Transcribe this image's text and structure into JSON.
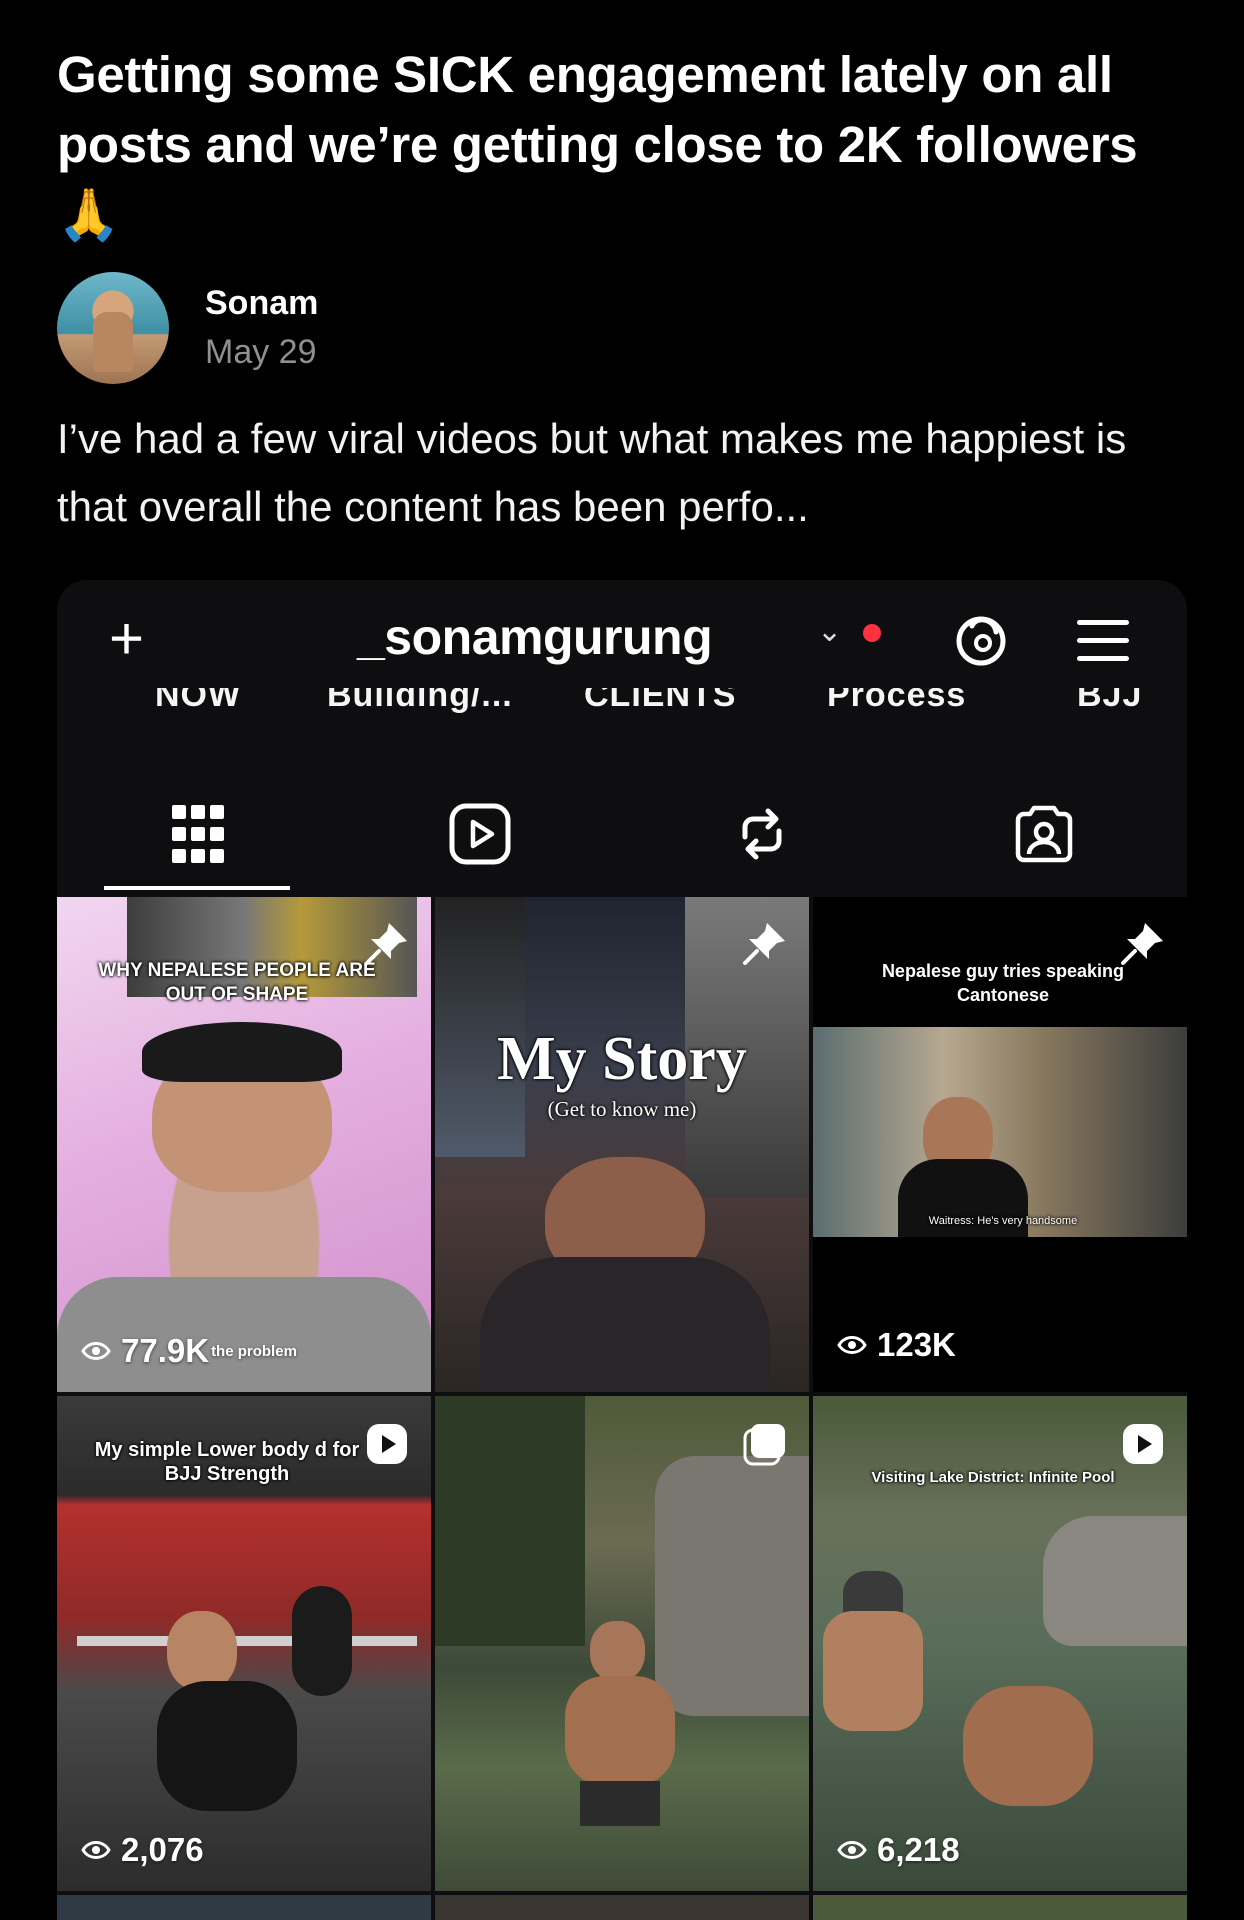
{
  "post": {
    "title": "Getting some SICK engagement lately on all posts and we’re getting close to 2K followers 🙏",
    "author": "Sonam",
    "date": "May 29",
    "body": "I’ve had a few viral videos but what makes me happiest is that overall the content has been perfo..."
  },
  "profile": {
    "username": "_sonamgurung",
    "highlights": [
      "NOW",
      "Building/...",
      "CLIENTS",
      "Process",
      "BJJ"
    ],
    "tabs": [
      "grid-icon",
      "reels-icon",
      "reposts-icon",
      "tagged-icon"
    ]
  },
  "grid": {
    "cells": [
      {
        "caption": "WHY NEPALESE PEOPLE ARE OUT OF SHAPE",
        "views": "77.9K",
        "subtitle": "the problem"
      },
      {
        "caption": "My Story",
        "subcaption": "(Get to know me)"
      },
      {
        "caption": "Nepalese guy tries speaking Cantonese",
        "subtitle": "Waitress: He's very handsome",
        "views": "123K"
      },
      {
        "caption": "My simple Lower body d for BJJ Strength",
        "views": "2,076"
      },
      {
        "caption": ""
      },
      {
        "caption": "Visiting Lake District: Infinite Pool",
        "views": "6,218"
      }
    ]
  },
  "colors": {
    "background": "#000000",
    "accent_dot": "#ff3040",
    "muted": "#8e8e93"
  }
}
